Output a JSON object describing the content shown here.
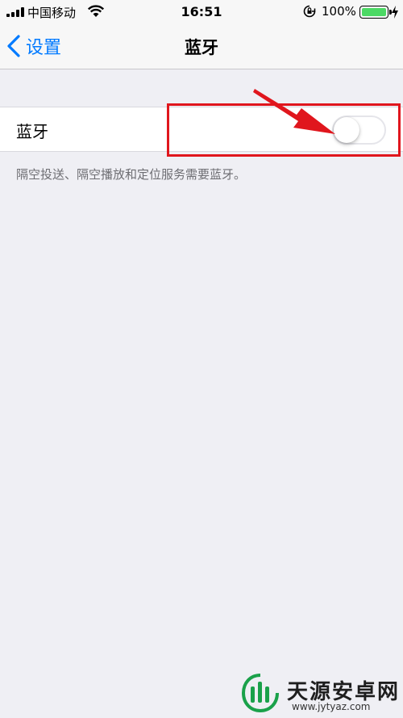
{
  "status_bar": {
    "carrier": "中国移动",
    "time": "16:51",
    "battery_percent": "100%",
    "battery_level": 1.0,
    "icons": [
      "signal-icon",
      "wifi-icon",
      "rotation-lock-icon",
      "battery-icon",
      "charging-icon"
    ]
  },
  "nav": {
    "back_label": "设置",
    "title": "蓝牙"
  },
  "bluetooth_row": {
    "label": "蓝牙",
    "toggle_on": false
  },
  "footer": {
    "text": "隔空投送、隔空播放和定位服务需要蓝牙。"
  },
  "watermark": {
    "text": "天源安卓网",
    "url": "www.jytyaz.com"
  },
  "colors": {
    "accent": "#007aff",
    "background": "#efeff4",
    "annotation": "#e0161d",
    "battery": "#4cd964"
  }
}
